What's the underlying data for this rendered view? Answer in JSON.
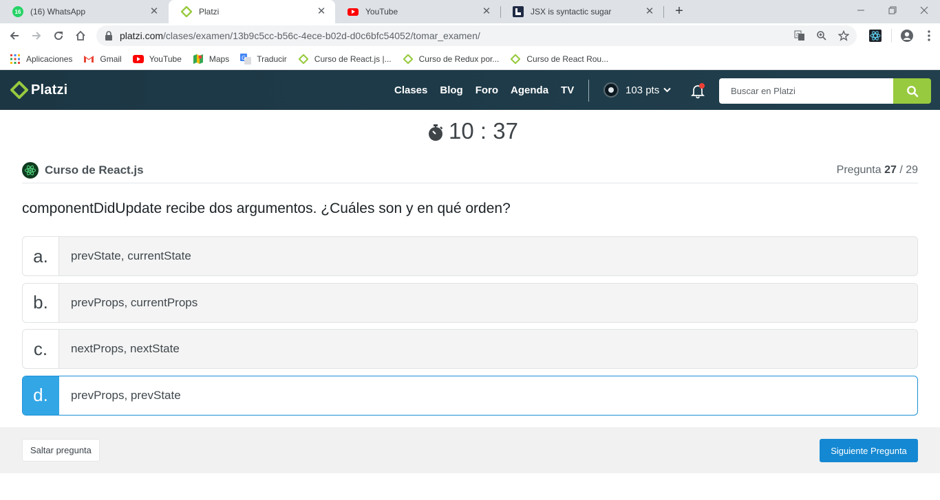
{
  "browser": {
    "tabs": [
      {
        "title": "(16) WhatsApp",
        "badge": "16"
      },
      {
        "title": "Platzi"
      },
      {
        "title": "YouTube"
      },
      {
        "title": "JSX is syntactic sugar"
      }
    ],
    "url_domain": "platzi.com",
    "url_path": "/clases/examen/13b9c5cc-b56c-4ece-b02d-d0c6bfc54052/tomar_examen/",
    "bookmarks": [
      {
        "label": "Aplicaciones",
        "icon": "apps-grid-icon"
      },
      {
        "label": "Gmail",
        "icon": "gmail-icon"
      },
      {
        "label": "YouTube",
        "icon": "youtube-icon"
      },
      {
        "label": "Maps",
        "icon": "maps-icon"
      },
      {
        "label": "Traducir",
        "icon": "translate-icon"
      },
      {
        "label": "Curso de React.js |...",
        "icon": "platzi-icon"
      },
      {
        "label": "Curso de Redux por...",
        "icon": "platzi-icon"
      },
      {
        "label": "Curso de React Rou...",
        "icon": "platzi-icon"
      }
    ]
  },
  "header": {
    "logo": "Platzi",
    "nav": [
      "Clases",
      "Blog",
      "Foro",
      "Agenda",
      "TV"
    ],
    "points": "103 pts",
    "search_placeholder": "Buscar en Platzi"
  },
  "exam": {
    "timer": "10 : 37",
    "course": "Curso de React.js",
    "question_label": "Pregunta",
    "question_current": "27",
    "question_total": "/ 29",
    "question": "componentDidUpdate recibe dos argumentos. ¿Cuáles son y en qué orden?",
    "answers": [
      {
        "letter": "a.",
        "text": "prevState, currentState",
        "selected": false
      },
      {
        "letter": "b.",
        "text": "prevProps, currentProps",
        "selected": false
      },
      {
        "letter": "c.",
        "text": "nextProps, nextState",
        "selected": false
      },
      {
        "letter": "d.",
        "text": "prevProps, prevState",
        "selected": true
      }
    ],
    "skip_label": "Saltar pregunta",
    "next_label": "Siguiente Pregunta"
  },
  "colors": {
    "header_bg": "#1e3a48",
    "accent_green": "#98ca3f",
    "selected_blue": "#33a6e6",
    "next_button": "#1488d2"
  }
}
